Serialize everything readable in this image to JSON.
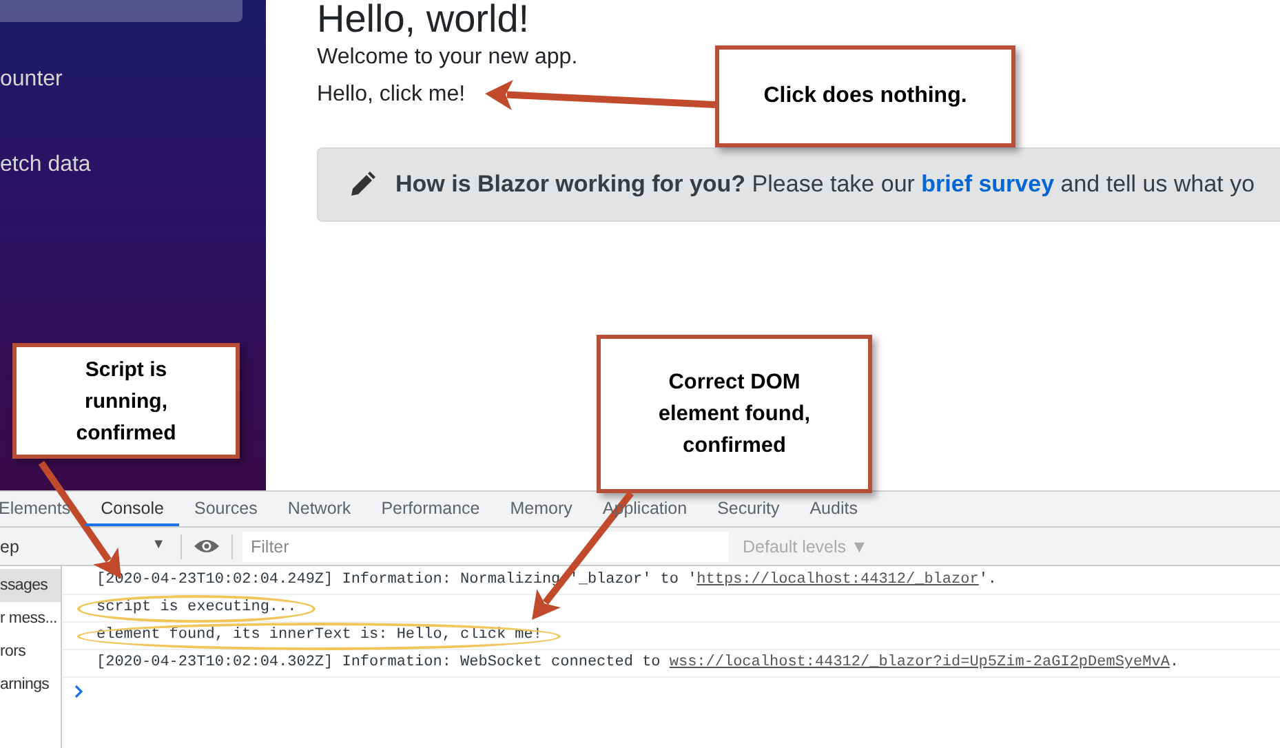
{
  "sidebar": {
    "items": [
      {
        "selected": true
      },
      {
        "label": "ounter",
        "selected": false
      },
      {
        "label": "etch data",
        "selected": false
      }
    ]
  },
  "main": {
    "heading": "Hello, world!",
    "paragraphs": [
      "Welcome to your new app.",
      "Hello, click me!"
    ],
    "alert": {
      "title": "How is Blazor working for you?",
      "lead": "Please take our",
      "link": "brief survey",
      "tail": "and tell us what yo"
    }
  },
  "devtools": {
    "tabs": [
      {
        "label": "Elements",
        "selected": false
      },
      {
        "label": "Console",
        "selected": true
      },
      {
        "label": "Sources",
        "selected": false
      },
      {
        "label": "Network",
        "selected": false
      },
      {
        "label": "Performance",
        "selected": false
      },
      {
        "label": "Memory",
        "selected": false
      },
      {
        "label": "Application",
        "selected": false
      },
      {
        "label": "Security",
        "selected": false
      },
      {
        "label": "Audits",
        "selected": false
      }
    ],
    "toolbar": {
      "context": "ep",
      "caret": "▼",
      "filter": {
        "placeholder": "Filter"
      },
      "levels": "Default levels",
      "levels_caret": "▼"
    },
    "sidebar": [
      {
        "label": "ssages",
        "selected": true
      },
      {
        "label": "r mess...",
        "selected": false
      },
      {
        "label": "rors",
        "selected": false
      },
      {
        "label": "arnings",
        "selected": false
      }
    ],
    "log": [
      {
        "text": "[2020-04-23T10:02:04.249Z] Information: Normalizing '_blazor' to '",
        "link": "https://localhost:44312/_blazor",
        "suffix": "'.",
        "circled": false
      },
      {
        "text": "script is executing...",
        "circled": true
      },
      {
        "text": "element found, its innerText is: Hello, click me!",
        "circled": true
      },
      {
        "text": "[2020-04-23T10:02:04.302Z] Information: WebSocket connected to ",
        "link": "wss://localhost:44312/_blazor?id=Up5Zim-2aGI2pDemSyeMvA",
        "suffix": ".",
        "circled": false
      }
    ]
  },
  "annotations": [
    {
      "text": "Click does nothing."
    },
    {
      "text": "Script is running, confirmed"
    },
    {
      "text": "Correct DOM element found, confirmed"
    }
  ]
}
